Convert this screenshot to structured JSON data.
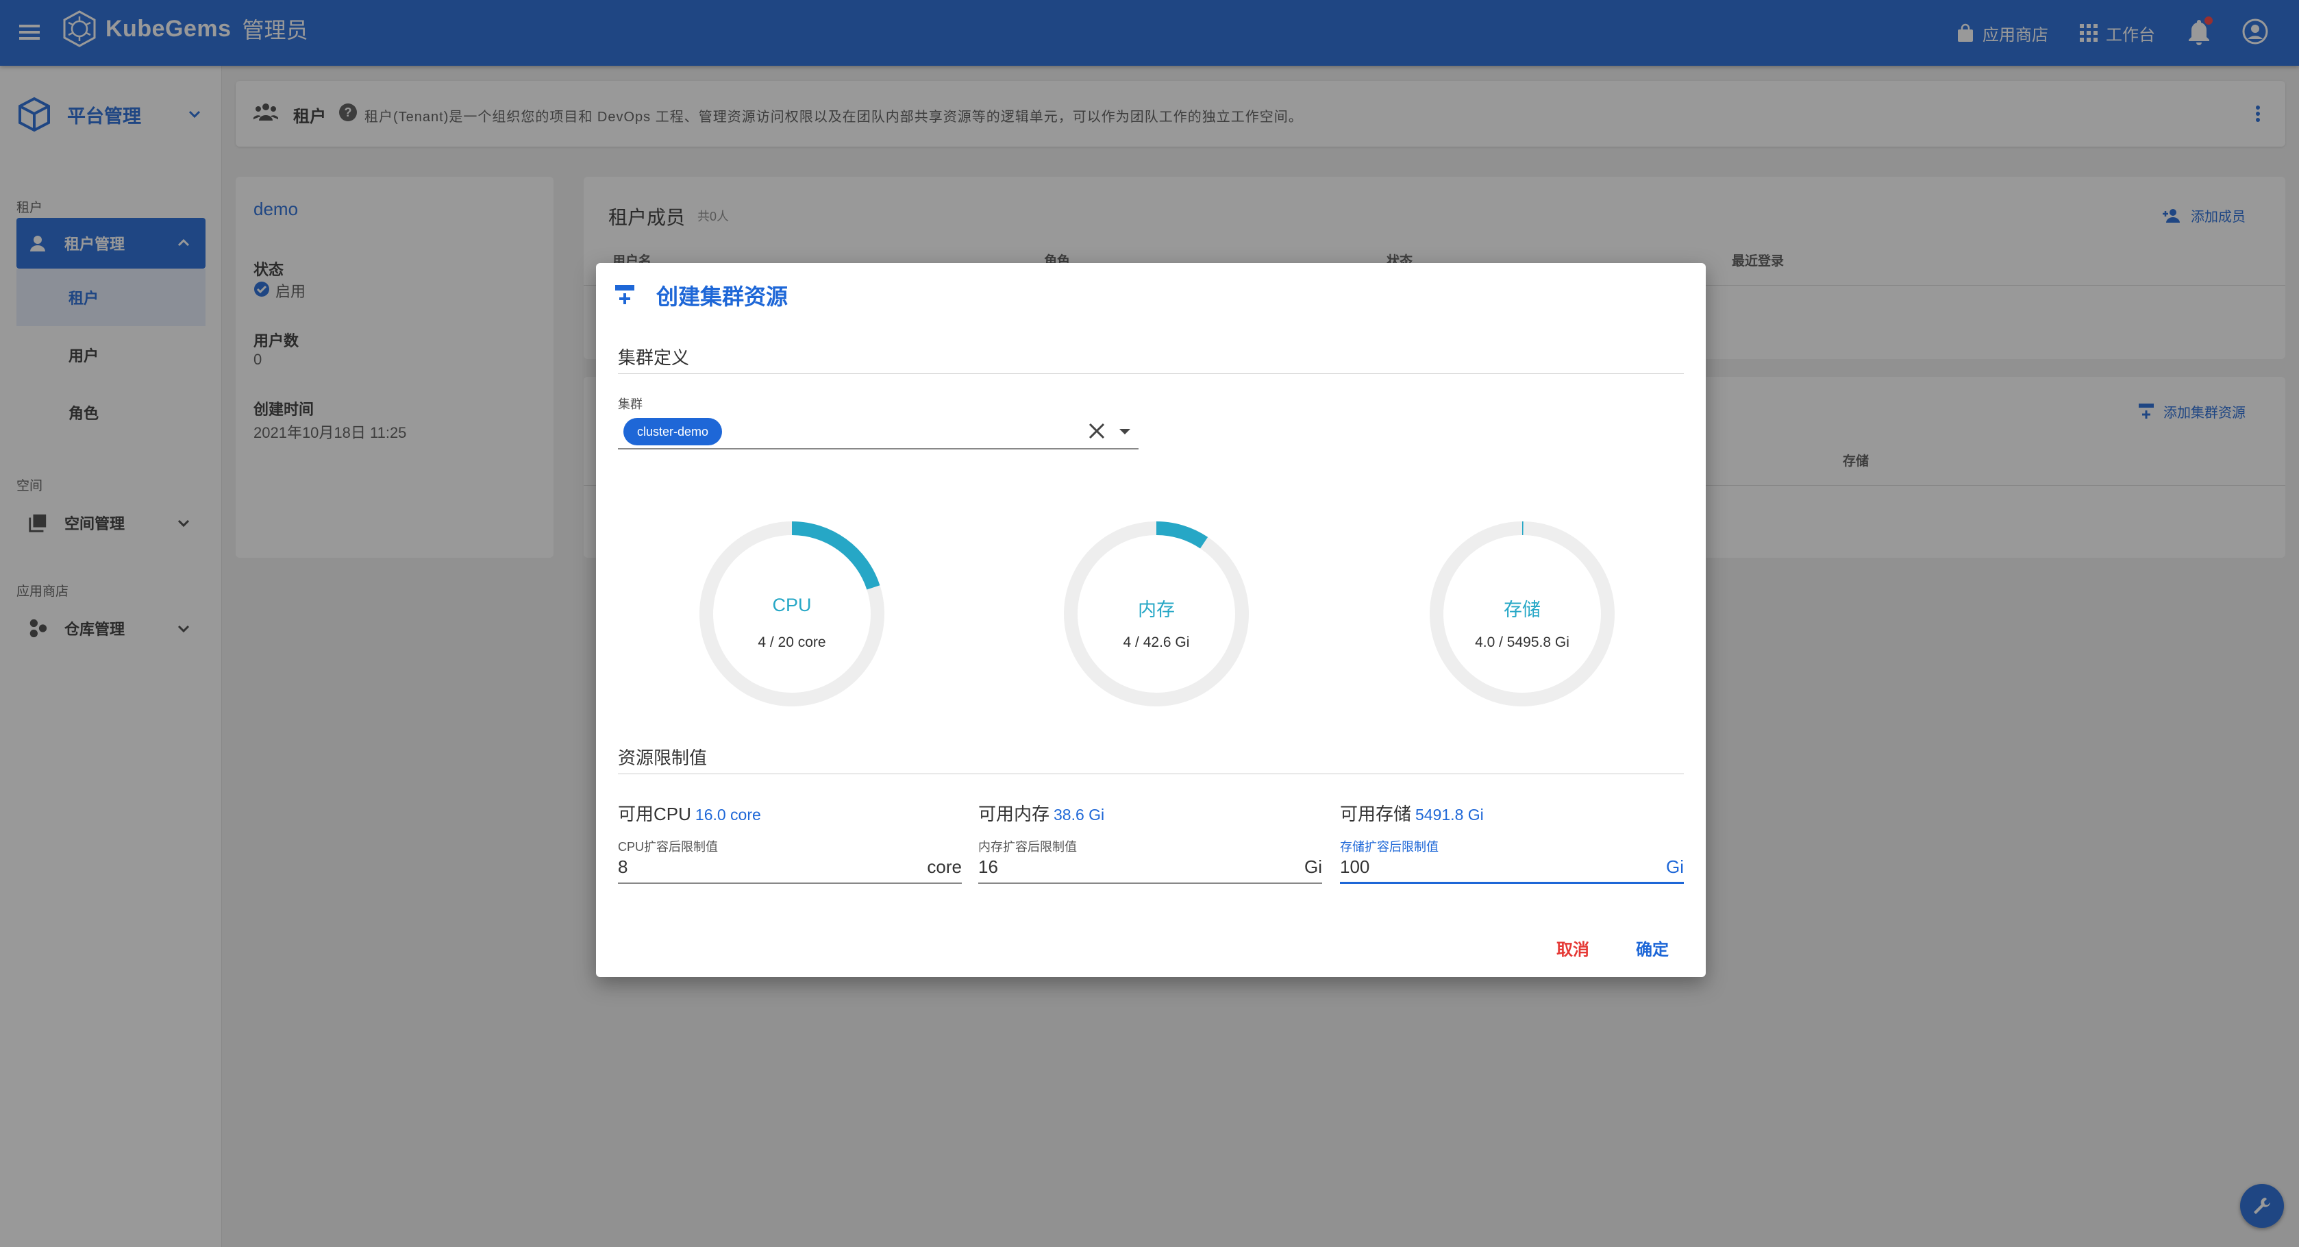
{
  "topbar": {
    "brand_name": "KubeGems",
    "role": "管理员",
    "app_store": "应用商店",
    "workbench": "工作台"
  },
  "sidenav": {
    "platform": "平台管理",
    "section_tenant": "租户",
    "tenant_mgmt": "租户管理",
    "items": [
      "租户",
      "用户",
      "角色"
    ],
    "section_space": "空间",
    "space_mgmt": "空间管理",
    "section_appstore": "应用商店",
    "repo_mgmt": "仓库管理"
  },
  "header": {
    "title": "租户",
    "description": "租户(Tenant)是一个组织您的项目和 DevOps 工程、管理资源访问权限以及在团队内部共享资源等的逻辑单元，可以作为团队工作的独立工作空间。"
  },
  "tenant": {
    "name": "demo",
    "status_label": "状态",
    "status_value": "启用",
    "user_count_label": "用户数",
    "user_count_value": "0",
    "created_label": "创建时间",
    "created_value": "2021年10月18日 11:25"
  },
  "members": {
    "title": "租户成员",
    "count": "共0人",
    "add_button": "添加成员",
    "columns": [
      "用户名",
      "角色",
      "状态",
      "最近登录"
    ]
  },
  "resources": {
    "add_button": "添加集群资源",
    "storage_col": "存储"
  },
  "dialog": {
    "title": "创建集群资源",
    "section_cluster": "集群定义",
    "cluster_label": "集群",
    "cluster_value": "cluster-demo",
    "usage": [
      {
        "label": "CPU",
        "used": 4,
        "total": 20,
        "text": "4 / 20 core"
      },
      {
        "label": "内存",
        "used": 4,
        "total": 42.6,
        "text": "4 / 42.6 Gi"
      },
      {
        "label": "存储",
        "used": 4.0,
        "total": 5495.8,
        "text": "4.0 / 5495.8 Gi"
      }
    ],
    "section_limits": "资源限制值",
    "limits": [
      {
        "avail_label": "可用CPU",
        "avail_value": "16.0 core",
        "input_label": "CPU扩容后限制值",
        "value": "8",
        "unit": "core"
      },
      {
        "avail_label": "可用内存",
        "avail_value": "38.6 Gi",
        "input_label": "内存扩容后限制值",
        "value": "16",
        "unit": "Gi"
      },
      {
        "avail_label": "可用存储",
        "avail_value": "5491.8 Gi",
        "input_label": "存储扩容后限制值",
        "value": "100",
        "unit": "Gi"
      }
    ],
    "cancel": "取消",
    "confirm": "确定"
  },
  "colors": {
    "primary": "#1e67d7",
    "gauge": "#26a7c6",
    "gauge_track": "#eeeeee",
    "cancel": "#e53935"
  }
}
